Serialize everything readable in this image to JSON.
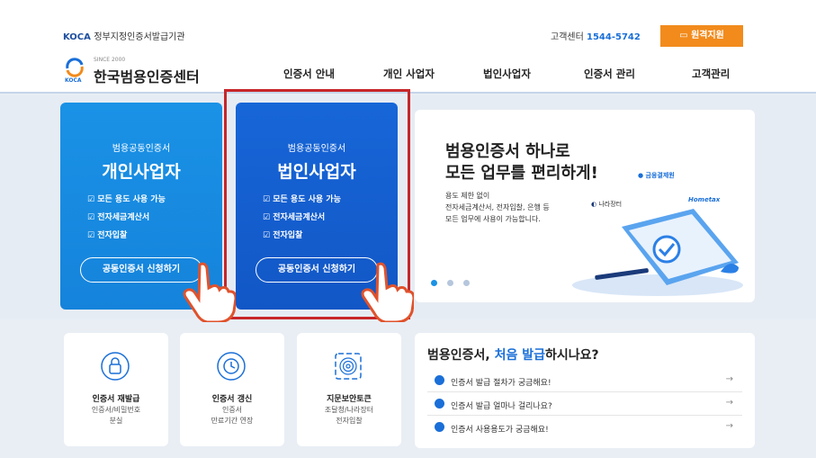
{
  "topbar": {
    "brand": "KOCA",
    "brand_sub": "정부지정인증서발급기관",
    "cs_label": "고객센터",
    "cs_phone": "1544-5742",
    "remote": "원격지원"
  },
  "header": {
    "since": "SINCE 2000",
    "logo_text": "한국범용인증센터",
    "logo_koca": "KOCA",
    "nav": [
      "인증서 안내",
      "개인 사업자",
      "법인사업자",
      "인증서 관리",
      "고객관리"
    ]
  },
  "cards": [
    {
      "sub": "범용공동인증서",
      "title": "개인사업자",
      "features": [
        "모든 용도 사용 가능",
        "전자세금계산서",
        "전자입찰"
      ],
      "apply": "공동인증서 신청하기"
    },
    {
      "sub": "범용공동인증서",
      "title": "법인사업자",
      "features": [
        "모든 용도 사용 가능",
        "전자세금계산서",
        "전자입찰"
      ],
      "apply": "공동인증서 신청하기"
    }
  ],
  "promo": {
    "line1": "범용인증서 하나로",
    "line2": "모든 업무를 편리하게!",
    "desc": [
      "용도 제한 없이",
      "전자세금계산서, 전자입찰, 은행 등",
      "모든 업무에 사용이 가능합니다."
    ],
    "logos": [
      "금융결제원",
      "나라장터",
      "Hometax"
    ]
  },
  "tiles": [
    {
      "icon": "lock-icon",
      "title": "인증서 재발급",
      "l2": "인증서/비밀번호",
      "l3": "분실"
    },
    {
      "icon": "clock-icon",
      "title": "인증서 갱신",
      "l2": "인증서",
      "l3": "만료기간 연장"
    },
    {
      "icon": "fingerprint-icon",
      "title": "지문보안토큰",
      "l2": "조달청/나라장터",
      "l3": "전자입찰"
    }
  ],
  "faq": {
    "heading_pre": "범용인증서, ",
    "heading_hl": "처음 발급",
    "heading_post": "하시나요?",
    "items": [
      "인증서 발급 절차가 궁금해요!",
      "인증서 발급 얼마나 걸리나요?",
      "인증서 사용용도가 궁금해요!"
    ],
    "arrow": "→"
  },
  "icons": {
    "check": "☑",
    "q": "Q"
  },
  "colors": {
    "accent": "#1a6fd8",
    "highlight_box": "#c7262a",
    "remote_btn": "#f28b1c"
  }
}
